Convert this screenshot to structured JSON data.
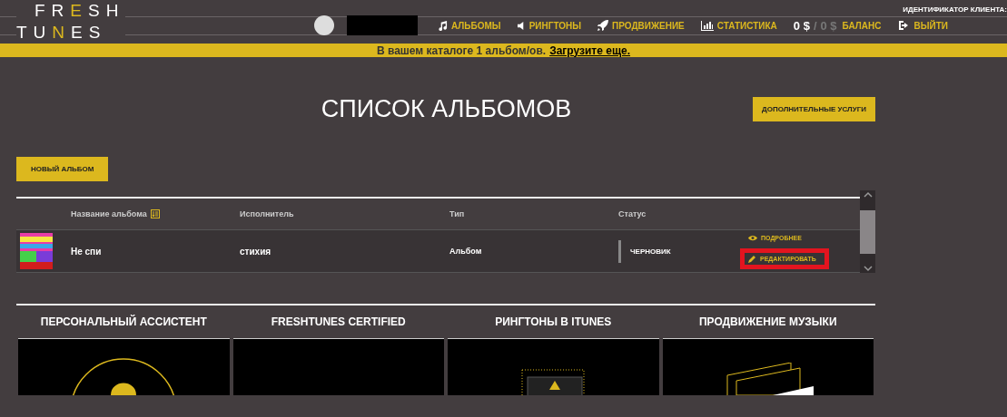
{
  "logo": {
    "line_1": "FRESH",
    "line_2": "TUNES"
  },
  "header": {
    "client_id_label": "ИДЕНТИФИКАТОР КЛИЕНТА:",
    "nav": [
      {
        "kind": "music",
        "label": "АЛЬБОМЫ"
      },
      {
        "kind": "speaker",
        "label": "РИНГТОНЫ"
      },
      {
        "kind": "rocket",
        "label": "ПРОДВИЖЕНИЕ"
      },
      {
        "kind": "chart",
        "label": "СТАТИСТИКА"
      }
    ],
    "balance": {
      "amount": "0 $",
      "separator": "/",
      "second_amount": "0 $",
      "label": "БАЛАНС"
    },
    "logout": "ВЫЙТИ"
  },
  "banner": {
    "text": "В вашем каталоге 1 альбом/ов.",
    "link": "Загрузите еще."
  },
  "page_title": "СПИСОК АЛЬБОМОВ",
  "extra_services_button": "ДОПОЛНИТЕЛЬНЫЕ УСЛУГИ",
  "new_album_button": "НОВЫЙ АЛЬБОМ",
  "table": {
    "columns": [
      "Название альбома",
      "Исполнитель",
      "Тип",
      "Статус"
    ],
    "rows": [
      {
        "title": "Не спи",
        "artist": "стихия",
        "type": "Альбом",
        "status": "ЧЕРНОВИК",
        "actions": [
          {
            "kind": "view",
            "label": "ПОДРОБНЕЕ",
            "highlighted": false
          },
          {
            "kind": "edit",
            "label": "РЕДАКТИРОВАТЬ",
            "highlighted": true
          }
        ]
      }
    ]
  },
  "cards": [
    {
      "title": "ПЕРСОНАЛЬНЫЙ АССИСТЕНТ",
      "kind": "assistant"
    },
    {
      "title": "FRESHTUNES CERTIFIED",
      "kind": "blank"
    },
    {
      "title": "РИНГТОНЫ В ITUNES",
      "kind": "ringtones"
    },
    {
      "title": "ПРОДВИЖЕНИЕ МУЗЫКИ",
      "kind": "promo"
    }
  ]
}
